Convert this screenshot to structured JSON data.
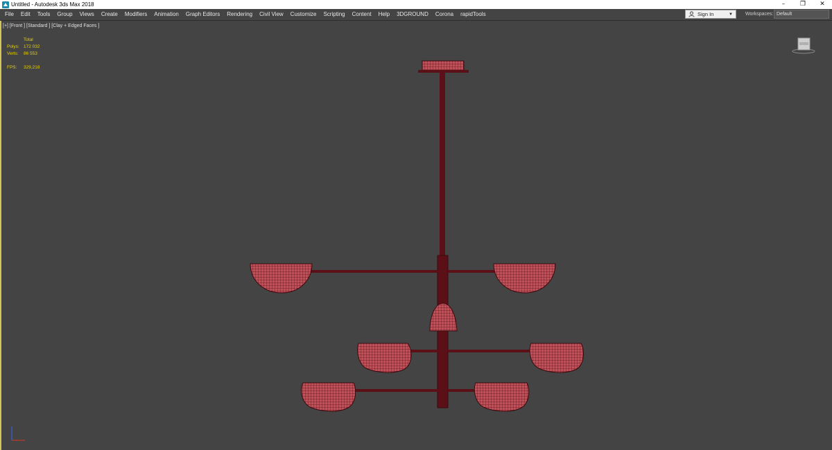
{
  "window": {
    "title": "Untitled - Autodesk 3ds Max 2018",
    "controls": [
      "–",
      "❐",
      "✕"
    ]
  },
  "menu": [
    "File",
    "Edit",
    "Tools",
    "Group",
    "Views",
    "Create",
    "Modifiers",
    "Animation",
    "Graph Editors",
    "Rendering",
    "Civil View",
    "Customize",
    "Scripting",
    "Content",
    "Help",
    "3DGROUND",
    "Corona",
    "rapidTools"
  ],
  "account": {
    "signin_label": "Sign In"
  },
  "workspaces": {
    "label": "Workspaces:",
    "value": "Default"
  },
  "viewport": {
    "label": "[+] [Front ] [Standard ] [Clay + Edged Faces ]",
    "stats": {
      "header": "Total",
      "polys_label": "Polys:",
      "polys_value": "172 032",
      "verts_label": "Verts:",
      "verts_value": "86 553",
      "fps_label": "FPS:",
      "fps_value": "329,218"
    },
    "model_color": "#c2505a",
    "wire_color": "#5a0f14",
    "stats_color": "#e6d200",
    "border_color": "#d2c65a"
  }
}
